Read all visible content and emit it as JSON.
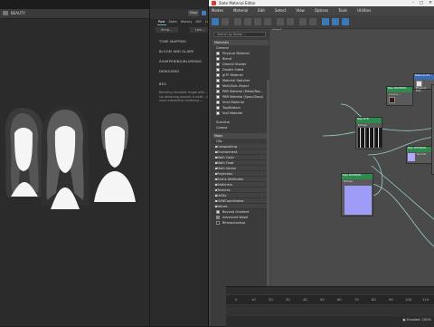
{
  "render_window": {
    "title": "BEAUTY"
  },
  "settings_panel": {
    "shop_label": "Shop",
    "tabs": [
      "Post",
      "Stats",
      "History",
      "Diff",
      "Li..."
    ],
    "subtabs": [
      "Simp...",
      "Lea..."
    ],
    "sections": [
      "TONE MAPPING",
      "BLOOM AND GLARE",
      "SHARPENING/BLURRING",
      "DENOISING",
      "BEO"
    ],
    "paragraph": "Blending denoised image with ... via denoising amount is avail... in more interactive rendering ..."
  },
  "slate": {
    "title": "Slate Material Editor",
    "window_controls": [
      "–",
      "□",
      "✕"
    ],
    "menu": [
      "Modes",
      "Material",
      "Edit",
      "Select",
      "View",
      "Options",
      "Tools",
      "Utilities"
    ],
    "view_tab": "View1",
    "search_placeholder": "Search by Name ...",
    "browser": {
      "materials_header": "Materials",
      "general_header": "General",
      "general_items": [
        "Physical Material",
        "Blend",
        "DirectX Shader",
        "Double Sided",
        "glTF Material",
        "Material Switcher",
        "Multi/Sub-Object",
        "PBR Material (Metal/Rou...",
        "PBR Material (Spec/Gloss)",
        "Shell Material",
        "Top/Bottom",
        "Null Material"
      ],
      "other_groups": [
        "Scanline",
        "Corona"
      ],
      "maps_header": "Maps",
      "osl_header": "OSL",
      "osl_categories": [
        "Compositing",
        "Environment",
        "Math Color",
        "Math Float",
        "Math Vector",
        "Projection",
        "Scene Attributes",
        "Switchers",
        "Textures",
        "Utility",
        "UVWCoordinates",
        "Values"
      ],
      "map_items": [
        "Beyond Gradient",
        "Advanced Wood",
        "BitmapLookup"
      ]
    },
    "nodes": {
      "node1_title": "Map #638458...",
      "node1_sub": "Corona...",
      "node2_title": "Material #3...",
      "node2_sub": "Physical Mat...",
      "node3_title": "Map #78",
      "node3_sub": "Bitmap",
      "node4_title": "Map #638458...",
      "node4_sub": "Normal",
      "node5_title": "Map #638458...",
      "node5_sub": "Bitmap"
    }
  },
  "timeline": {
    "ticks": [
      "0",
      "10",
      "20",
      "30",
      "40",
      "50",
      "60",
      "70",
      "80",
      "90",
      "100",
      "110"
    ],
    "status_prefix": "Enabled:",
    "status": "100%"
  }
}
